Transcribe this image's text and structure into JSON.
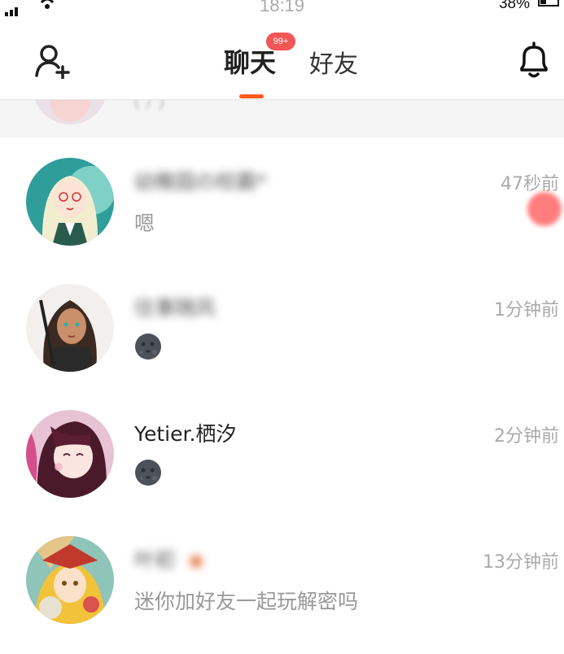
{
  "status_bar": {
    "time": "18:19",
    "battery": "38%"
  },
  "header": {
    "tabs": [
      {
        "label": "聊天",
        "badge": "99+"
      },
      {
        "label": "好友"
      }
    ],
    "accent_color": "#ff5a1f",
    "icons": {
      "left": "add-friend-icon",
      "right": "bell-icon"
    }
  },
  "pinned": {
    "preview": "(  /  )"
  },
  "chats": [
    {
      "name": "幼稚园の校霸*",
      "preview": "嗯",
      "time": "47秒前",
      "name_blurred": true
    },
    {
      "name": "往事随风",
      "preview": "",
      "emoji": "new-moon-face",
      "time": "1分钟前",
      "name_blurred": true,
      "unread": true
    },
    {
      "name": "Yetier.栖汐",
      "preview": "",
      "emoji": "new-moon-face",
      "time": "2分钟前",
      "name_blurred": false
    },
    {
      "name": "叶初",
      "preview": "迷你加好友一起玩解密吗",
      "time": "13分钟前",
      "name_blurred": true
    }
  ]
}
